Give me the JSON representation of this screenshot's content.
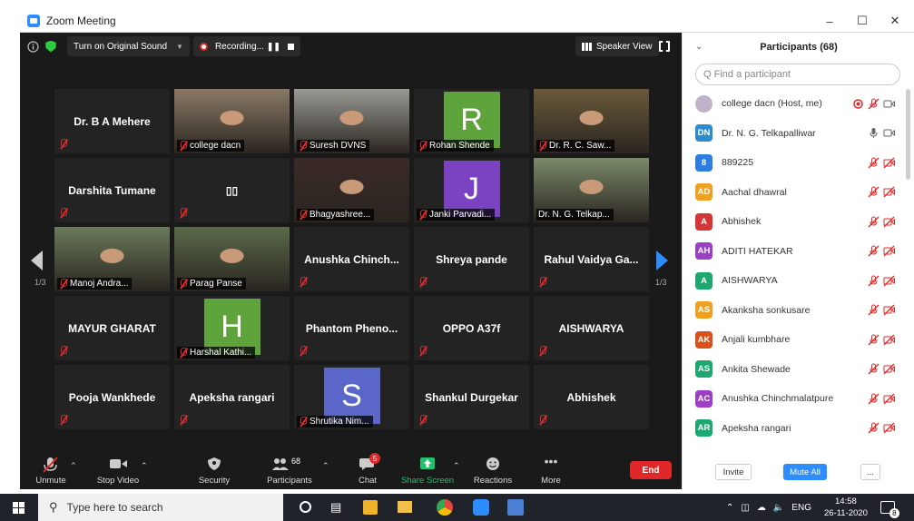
{
  "window": {
    "title": "Zoom Meeting",
    "minimize": "–",
    "maximize": "☐",
    "close": "✕"
  },
  "top_strip": {
    "original_sound": "Turn on Original Sound",
    "recording": "Recording...",
    "speaker_view": "Speaker View"
  },
  "pagination": {
    "left": "1/3",
    "right": "1/3"
  },
  "tiles": [
    {
      "name": "Dr. B A Mehere",
      "kind": "name"
    },
    {
      "name": "college dacn",
      "kind": "video",
      "bg": "#8a7a66"
    },
    {
      "name": "Suresh DVNS",
      "kind": "video",
      "bg": "#9a9a94"
    },
    {
      "name": "Rohan Shende",
      "kind": "avatar",
      "initial": "R",
      "color": "#5ea33b"
    },
    {
      "name": "Dr. R. C. Saw...",
      "kind": "video",
      "bg": "#6a5a3a"
    },
    {
      "name": "Darshita Tumane",
      "kind": "name"
    },
    {
      "name": "▯▯",
      "kind": "name"
    },
    {
      "name": "Bhagyashree...",
      "kind": "video",
      "bg": "#3a2a28"
    },
    {
      "name": "Janki Parvadi...",
      "kind": "avatar",
      "initial": "J",
      "color": "#7b43c2"
    },
    {
      "name": "Dr. N. G. Telkap...",
      "kind": "video",
      "bg": "#7a8a6a",
      "active": true
    },
    {
      "name": "Manoj Andra...",
      "kind": "video",
      "bg": "#6a7a5a"
    },
    {
      "name": "Parag Panse",
      "kind": "video",
      "bg": "#5a6a4a"
    },
    {
      "name": "Anushka Chinch...",
      "kind": "name"
    },
    {
      "name": "Shreya pande",
      "kind": "name"
    },
    {
      "name": "Rahul Vaidya Ga...",
      "kind": "name"
    },
    {
      "name": "MAYUR GHARAT",
      "kind": "name"
    },
    {
      "name": "Harshal Kathi...",
      "kind": "avatar",
      "initial": "H",
      "color": "#5ea33b"
    },
    {
      "name": "Phantom Pheno...",
      "kind": "name"
    },
    {
      "name": "OPPO A37f",
      "kind": "name"
    },
    {
      "name": "AISHWARYA",
      "kind": "name"
    },
    {
      "name": "Pooja Wankhede",
      "kind": "name"
    },
    {
      "name": "Apeksha rangari",
      "kind": "name"
    },
    {
      "name": "Shrutika Nim...",
      "kind": "avatar",
      "initial": "S",
      "color": "#5a66c8"
    },
    {
      "name": "Shankul Durgekar",
      "kind": "name"
    },
    {
      "name": "Abhishek",
      "kind": "name"
    }
  ],
  "toolbar": {
    "unmute": "Unmute",
    "stop_video": "Stop Video",
    "security": "Security",
    "participants": "Participants",
    "participants_count": "68",
    "chat": "Chat",
    "chat_badge": "5",
    "share_screen": "Share Screen",
    "reactions": "Reactions",
    "more": "More",
    "end": "End"
  },
  "panel": {
    "title": "Participants (68)",
    "search_placeholder": "Q Find a participant",
    "invite": "Invite",
    "mute_all": "Mute All",
    "more": "...",
    "participants": [
      {
        "initials": "",
        "name": "college dacn (Host, me)",
        "color": "#bfb3c9",
        "host": true
      },
      {
        "initials": "DN",
        "name": "Dr. N. G. Telkapalliwar",
        "color": "#2d8cd0",
        "unmuted": true
      },
      {
        "initials": "8",
        "name": "889225",
        "color": "#2d7de0"
      },
      {
        "initials": "AD",
        "name": "Aachal dhawral",
        "color": "#f0a020"
      },
      {
        "initials": "A",
        "name": "Abhishek",
        "color": "#d63535"
      },
      {
        "initials": "AH",
        "name": "ADITI HATEKAR",
        "color": "#9b3fc4"
      },
      {
        "initials": "A",
        "name": "AISHWARYA",
        "color": "#1ea870"
      },
      {
        "initials": "AS",
        "name": "Akanksha sonkusare",
        "color": "#f0a020"
      },
      {
        "initials": "AK",
        "name": "Anjali kumbhare",
        "color": "#d9501a"
      },
      {
        "initials": "AS",
        "name": "Ankita Shewade",
        "color": "#1ea870"
      },
      {
        "initials": "AC",
        "name": "Anushka Chinchmalatpure",
        "color": "#9b3fc4"
      },
      {
        "initials": "AR",
        "name": "Apeksha rangari",
        "color": "#1ea870"
      }
    ]
  },
  "taskbar": {
    "search_text": "Type here to search",
    "lang": "ENG",
    "time": "14:58",
    "date": "26-11-2020",
    "notif": "8"
  }
}
